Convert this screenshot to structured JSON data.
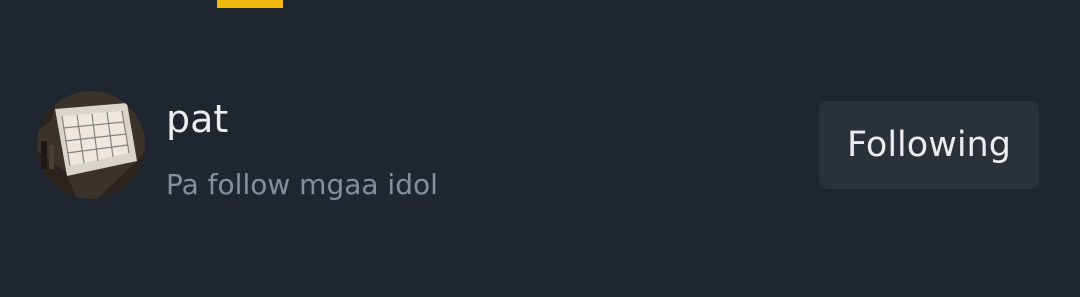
{
  "tabs": {
    "active_indicator_color": "#f0b90b"
  },
  "user": {
    "username": "pat",
    "bio": "Pa follow mgaa idol",
    "avatar_icon": "avatar-photo-glass-dome"
  },
  "actions": {
    "follow_label": "Following"
  },
  "colors": {
    "background": "#1f2630",
    "button_bg": "#2b3139",
    "primary_text": "#eaecef",
    "secondary_text": "#848e9c"
  }
}
